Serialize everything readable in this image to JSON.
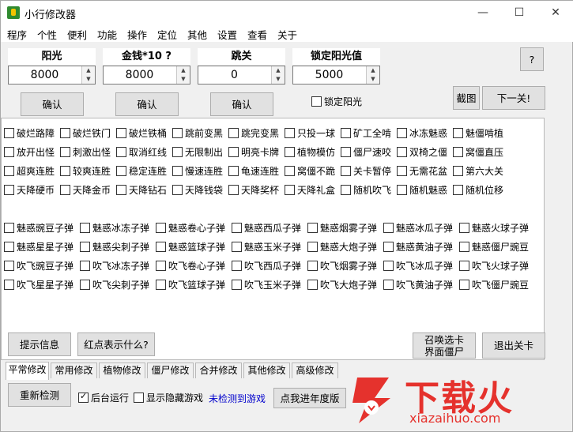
{
  "window": {
    "title": "小行修改器",
    "min_glyph": "—",
    "max_glyph": "☐",
    "close_glyph": "✕"
  },
  "menu": [
    "程序",
    "个性",
    "便利",
    "功能",
    "操作",
    "定位",
    "其他",
    "设置",
    "查看",
    "关于"
  ],
  "fields": [
    {
      "label": "阳光",
      "value": "8000",
      "button": "确认"
    },
    {
      "label": "金钱*10 ?",
      "value": "8000",
      "button": "确认"
    },
    {
      "label": "跳关",
      "value": "0",
      "button": "确认"
    },
    {
      "label": "锁定阳光值",
      "value": "5000"
    }
  ],
  "lock_sun_label": "锁定阳光",
  "help_button": "?",
  "screenshot_button": "截图",
  "next_level_button": "下一关!",
  "options_rows": [
    [
      "破烂路障",
      "破烂铁门",
      "破烂铁桶",
      "跳前变黑",
      "跳完变黑",
      "只投一球",
      "矿工全啃",
      "冰冻魅惑",
      "魅僵啃植"
    ],
    [
      "放开出怪",
      "刺激出怪",
      "取消红线",
      "无限制出",
      "明亮卡牌",
      "植物模仿",
      "僵尸速咬",
      "双椅之僵",
      "窝僵直压"
    ],
    [
      "超爽连胜",
      "较爽连胜",
      "稳定连胜",
      "慢速连胜",
      "龟速连胜",
      "窝僵不跪",
      "关卡暂停",
      "无需花盆",
      "第六大关"
    ],
    [
      "天降硬币",
      "天降金币",
      "天降钻石",
      "天降钱袋",
      "天降奖杯",
      "天降礼盒",
      "随机吹飞",
      "随机魅惑",
      "随机位移"
    ]
  ],
  "bullets_rows": [
    [
      "魅惑豌豆子弹",
      "魅惑冰冻子弹",
      "魅惑卷心子弹",
      "魅惑西瓜子弹",
      "魅惑烟雾子弹",
      "魅惑冰瓜子弹",
      "魅惑火球子弹"
    ],
    [
      "魅惑星星子弹",
      "魅惑尖刺子弹",
      "魅惑篮球子弹",
      "魅惑玉米子弹",
      "魅惑大炮子弹",
      "魅惑黄油子弹",
      "魅惑僵尸豌豆"
    ],
    [
      "吹飞豌豆子弹",
      "吹飞冰冻子弹",
      "吹飞卷心子弹",
      "吹飞西瓜子弹",
      "吹飞烟雾子弹",
      "吹飞冰瓜子弹",
      "吹飞火球子弹"
    ],
    [
      "吹飞星星子弹",
      "吹飞尖刺子弹",
      "吹飞篮球子弹",
      "吹飞玉米子弹",
      "吹飞大炮子弹",
      "吹飞黄油子弹",
      "吹飞僵尸豌豆"
    ]
  ],
  "bottom_buttons": {
    "hint": "提示信息",
    "red_dot": "红点表示什么?",
    "summon_line1": "召唤选卡",
    "summon_line2": "界面僵尸",
    "exit_level": "退出关卡"
  },
  "tabs": [
    "平常修改",
    "常用修改",
    "植物修改",
    "僵尸修改",
    "合并修改",
    "其他修改",
    "高级修改"
  ],
  "footer": {
    "recheck": "重新检测",
    "bg_run": "后台运行",
    "show_hidden": "显示隐藏游戏",
    "status": "未检测到游戏",
    "annual": "点我进年度版"
  },
  "watermark": {
    "brand": "下载火",
    "domain": "xiazaihuo.com"
  },
  "colors": {
    "status": "#0000cc",
    "brand": "#e5322d"
  }
}
